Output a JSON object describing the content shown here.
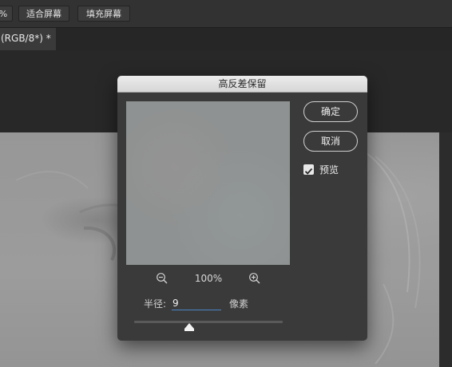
{
  "options_bar": {
    "partial_label": "% ",
    "fit_screen_label": "适合屏幕",
    "fill_screen_label": "填充屏幕"
  },
  "document_tab": {
    "title": "(RGB/8*) *"
  },
  "dialog": {
    "title": "高反差保留",
    "ok_label": "确定",
    "cancel_label": "取消",
    "preview_label": "预览",
    "preview_checked": true,
    "zoom_level": "100%",
    "zoom_out_icon": "zoom-out-icon",
    "zoom_in_icon": "zoom-in-icon",
    "radius_label": "半径:",
    "radius_value": "9",
    "radius_unit": "像素"
  },
  "colors": {
    "accent": "#4a86c7",
    "dialog_bg": "#3a3a3a",
    "title_bar": "#e0e0e0"
  }
}
